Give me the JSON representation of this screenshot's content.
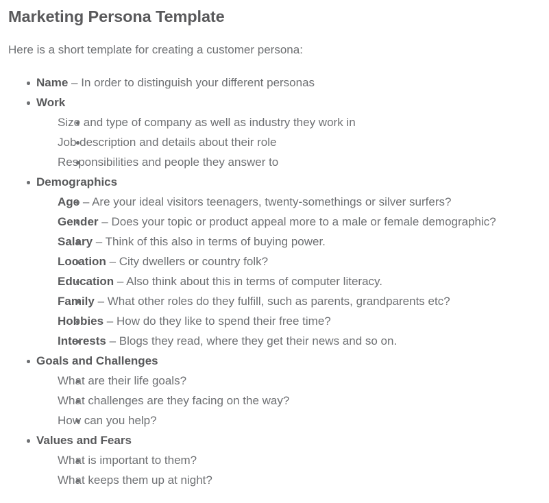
{
  "document": {
    "title": "Marketing Persona Template",
    "intro": "Here is a short template for creating a customer persona:",
    "dash": "–"
  },
  "outline": [
    {
      "term": "Name",
      "desc": "In order to distinguish your different personas",
      "children": []
    },
    {
      "term": "Work",
      "desc": "",
      "children": [
        {
          "text": "Size and type of company as well as industry they work in"
        },
        {
          "text": "Job description and details about their role"
        },
        {
          "text": "Responsibilities and people they answer to"
        }
      ]
    },
    {
      "term": "Demographics",
      "desc": "",
      "children": [
        {
          "term": "Age",
          "desc": "Are your ideal visitors teenagers, twenty-somethings or silver surfers?"
        },
        {
          "term": "Gender",
          "desc": "Does your topic or product appeal more to a male or female demographic?"
        },
        {
          "term": "Salary",
          "desc": "Think of this also in terms of buying power."
        },
        {
          "term": "Location",
          "desc": "City dwellers or country folk?"
        },
        {
          "term": "Education",
          "desc": "Also think about this in terms of computer literacy."
        },
        {
          "term": "Family",
          "desc": "What other roles do they fulfill, such as parents, grandparents etc?"
        },
        {
          "term": "Hobbies",
          "desc": "How do they like to spend their free time?"
        },
        {
          "term": "Interests",
          "desc": "Blogs they read, where they get their news and so on."
        }
      ]
    },
    {
      "term": "Goals and Challenges",
      "desc": "",
      "children": [
        {
          "text": "What are their life goals?"
        },
        {
          "text": "What challenges are they facing on the way?"
        },
        {
          "text": "How can you help?"
        }
      ]
    },
    {
      "term": "Values and Fears",
      "desc": "",
      "children": [
        {
          "text": "What is important to them?"
        },
        {
          "text": "What keeps them up at night?"
        }
      ]
    }
  ],
  "colors": {
    "background": "#ffffff",
    "heading": "#59595b",
    "term": "#58595b",
    "body": "#6e7073",
    "bullet": "#6e7073"
  }
}
